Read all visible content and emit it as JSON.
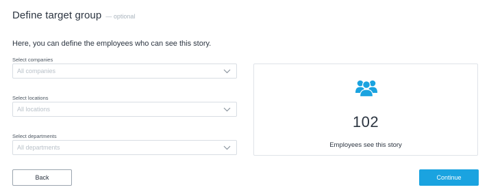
{
  "header": {
    "title": "Define target group",
    "optional_tag": "— optional"
  },
  "intro_text": "Here, you can define the employees who can see this story.",
  "fields": [
    {
      "label": "Select companies",
      "value": "All companies"
    },
    {
      "label": "Select locations",
      "value": "All locations"
    },
    {
      "label": "Select departments",
      "value": "All departments"
    }
  ],
  "summary": {
    "icon": "users-group-icon",
    "count": "102",
    "caption": "Employees see this story"
  },
  "buttons": {
    "back_label": "Back",
    "continue_label": "Continue"
  },
  "colors": {
    "accent": "#1aa3e0",
    "text": "#2b3440",
    "muted": "#a9b3bd",
    "border": "#d8dde3"
  }
}
